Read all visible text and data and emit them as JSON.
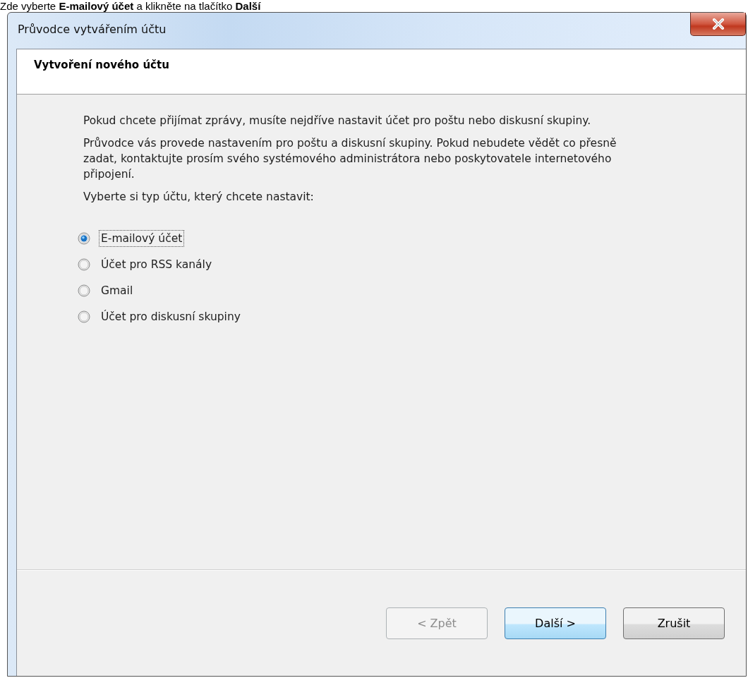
{
  "caption": "Zde vyberte **E-mailový účet** a klikněte na tlačítko **Další**",
  "window": {
    "title": "Průvodce vytvářením účtu"
  },
  "header": {
    "title": "Vytvoření nového účtu"
  },
  "paragraphs": [
    "Pokud chcete přijímat zprávy, musíte nejdříve nastavit účet pro poštu nebo diskusní skupiny.",
    "Průvodce vás provede nastavením pro poštu a diskusní skupiny. Pokud nebudete vědět co přesně zadat, kontaktujte prosím svého systémového administrátora nebo poskytovatele internetového připojení.",
    "Vyberte si typ účtu, který chcete nastavit:"
  ],
  "account_types": [
    {
      "label": "E-mailový účet",
      "selected": true,
      "focused": true
    },
    {
      "label": "Účet pro RSS kanály",
      "selected": false,
      "focused": false
    },
    {
      "label": "Gmail",
      "selected": false,
      "focused": false
    },
    {
      "label": "Účet pro diskusní skupiny",
      "selected": false,
      "focused": false
    }
  ],
  "buttons": [
    {
      "label": "< Zpět",
      "disabled": true,
      "default": false
    },
    {
      "label": "Další >",
      "disabled": false,
      "default": true
    },
    {
      "label": "Zrušit",
      "disabled": false,
      "default": false
    }
  ]
}
